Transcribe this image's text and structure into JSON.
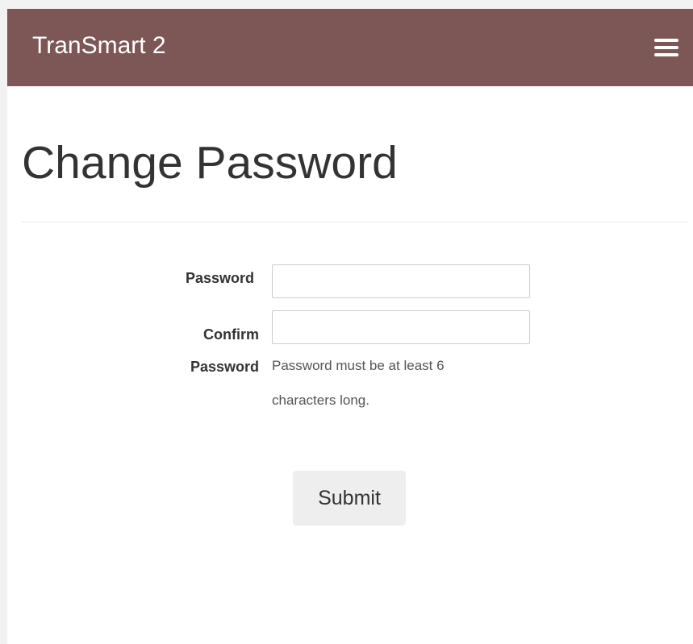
{
  "navbar": {
    "brand": "TranSmart 2",
    "menu_icon": "hamburger-icon"
  },
  "page": {
    "title": "Change Password"
  },
  "form": {
    "password": {
      "label": "Password",
      "value": "",
      "placeholder": ""
    },
    "confirm_password": {
      "label_line1": "Confirm",
      "label_line2": "Password",
      "value": "",
      "placeholder": ""
    },
    "help_text": "Password must be at least 6 characters long.",
    "submit_label": "Submit"
  },
  "colors": {
    "navbar_background": "#7d5656",
    "navbar_text": "#ffffff",
    "submit_background": "#eeeeee"
  }
}
